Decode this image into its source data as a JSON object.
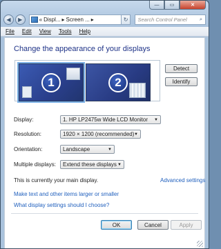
{
  "window": {
    "caption": {
      "minimize": "—",
      "maximize": "▭",
      "close": "✕"
    }
  },
  "navbar": {
    "back_icon": "back-arrow-icon",
    "forward_icon": "forward-arrow-icon",
    "address_segments": [
      "«",
      "Displ...",
      "▸",
      "Screen ...",
      "▸"
    ],
    "search_placeholder": "Search Control Panel"
  },
  "menu": [
    {
      "label": "File"
    },
    {
      "label": "Edit"
    },
    {
      "label": "View"
    },
    {
      "label": "Tools"
    },
    {
      "label": "Help"
    }
  ],
  "heading": "Change the appearance of your displays",
  "monitors": [
    {
      "number": "1",
      "selected": true
    },
    {
      "number": "2",
      "selected": false
    }
  ],
  "side_buttons": {
    "detect": "Detect",
    "identify": "Identify"
  },
  "settings": {
    "display": {
      "label": "Display:",
      "value": "1. HP LP2475w Wide LCD Monitor"
    },
    "resolution": {
      "label": "Resolution:",
      "value": "1920 × 1200 (recommended)"
    },
    "orientation": {
      "label": "Orientation:",
      "value": "Landscape"
    },
    "multiple": {
      "label": "Multiple displays:",
      "value": "Extend these displays"
    }
  },
  "main_display_text": "This is currently your main display.",
  "links": {
    "advanced": "Advanced settings",
    "text_size": "Make text and other items larger or smaller",
    "help": "What display settings should I choose?"
  },
  "buttons": {
    "ok": "OK",
    "cancel": "Cancel",
    "apply": "Apply"
  },
  "colors": {
    "heading": "#1e3287",
    "link": "#1f5fbd",
    "monitor": "#2a3f8c"
  }
}
